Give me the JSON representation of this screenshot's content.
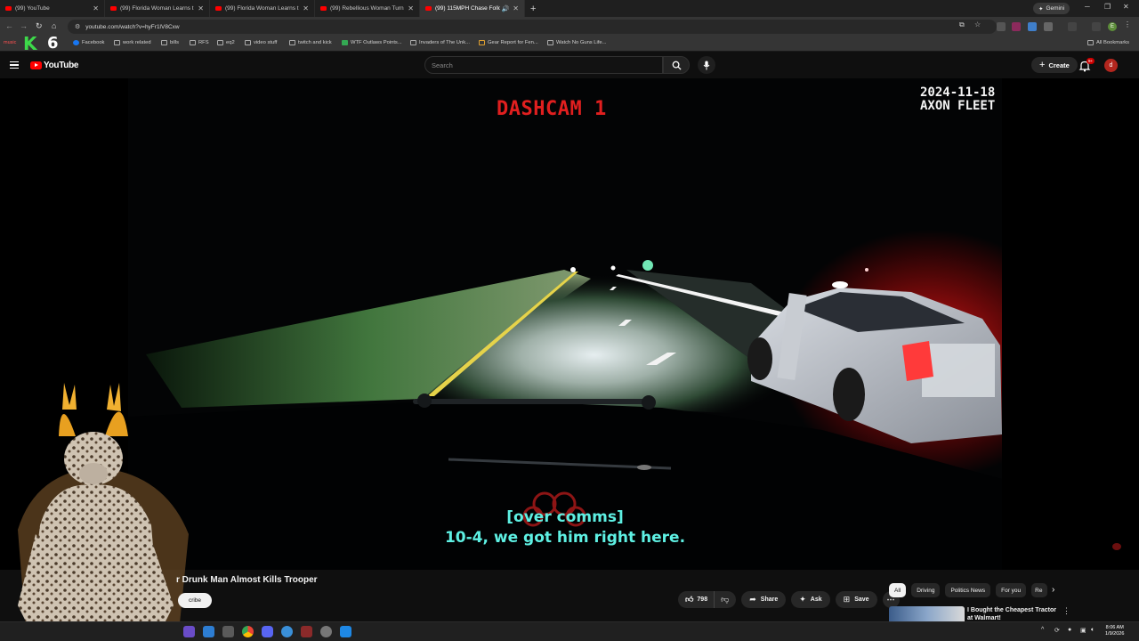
{
  "browser": {
    "tabs": [
      {
        "title": "(99) YouTube",
        "active": false
      },
      {
        "title": "(99) Florida Woman Learns the",
        "active": false
      },
      {
        "title": "(99) Florida Woman Learns the",
        "active": false
      },
      {
        "title": "(99) Rebellious Woman Turns S",
        "active": false
      },
      {
        "title": "(99) 115MPH Chase Follow",
        "active": true
      }
    ],
    "gemini_label": "Gemini",
    "url": "youtube.com/watch?v=hyFr1lV8Cxw",
    "profile_initial": "E",
    "bookmarks": [
      {
        "label": "Facebook",
        "icon": "facebook-icon"
      },
      {
        "label": "work related",
        "icon": "folder-icon"
      },
      {
        "label": "bills",
        "icon": "folder-icon"
      },
      {
        "label": "RFS",
        "icon": "folder-icon"
      },
      {
        "label": "eq2",
        "icon": "folder-icon"
      },
      {
        "label": "video stuff",
        "icon": "folder-icon"
      },
      {
        "label": "twitch and kick",
        "icon": "folder-icon"
      },
      {
        "label": "WTF Outlaws Points...",
        "icon": "sheet-icon"
      },
      {
        "label": "Invaders of The Unk...",
        "icon": "page-icon"
      },
      {
        "label": "Gear Report for Fen...",
        "icon": "page-icon"
      },
      {
        "label": "Watch No Guns Life...",
        "icon": "page-icon"
      }
    ],
    "all_bookmarks": "All Bookmarks",
    "brand_logo_k": "K",
    "brand_logo_6": "6",
    "music_label": "music"
  },
  "youtube": {
    "logo_text": "YouTube",
    "search_placeholder": "Search",
    "create_label": "Create",
    "notif_badge": "9+",
    "avatar_initial": "d"
  },
  "video": {
    "cam_label": "DASHCAM 1",
    "stamp_date": "2024-11-18",
    "stamp_system": "AXON FLEET",
    "caption_line1": "[over comms]",
    "caption_line2": "10-4, we got him right here.",
    "title_visible": "r Drunk Man Almost Kills Trooper",
    "subscribe_label": "cribe"
  },
  "actions": {
    "like_count": "798",
    "share": "Share",
    "ask": "Ask",
    "save": "Save"
  },
  "sidebar": {
    "chips": [
      {
        "label": "All",
        "active": true
      },
      {
        "label": "Driving",
        "active": false
      },
      {
        "label": "Politics News",
        "active": false
      },
      {
        "label": "For you",
        "active": false
      },
      {
        "label": "Re",
        "active": false
      }
    ],
    "reco_title": "I Bought the Cheapest Tractor at Walmart!"
  },
  "taskbar": {
    "time": "8:06 AM",
    "date": "1/9/2026"
  },
  "colors": {
    "yt_red": "#ff0000",
    "cam_label": "#e01f1f",
    "caption": "#5ef0e3",
    "bg": "#0f0f0f"
  }
}
